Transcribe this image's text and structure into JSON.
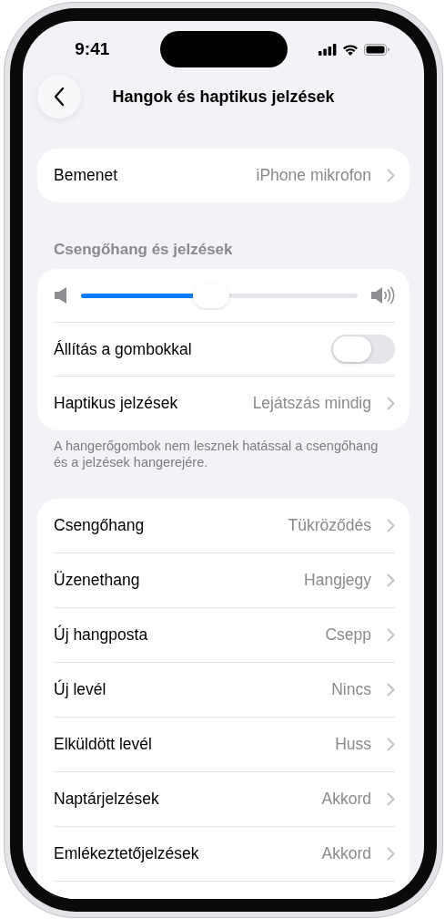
{
  "status_bar": {
    "time": "9:41"
  },
  "nav": {
    "title": "Hangok és haptikus jelzések"
  },
  "groups": [
    {
      "rows": [
        {
          "kind": "link",
          "label": "Bemenet",
          "value": "iPhone mikrofon"
        }
      ]
    },
    {
      "header": "Csengőhang és jelzések",
      "rows": [
        {
          "kind": "slider",
          "level": 0.47
        },
        {
          "kind": "toggle",
          "label": "Állítás a gombokkal",
          "on": false
        },
        {
          "kind": "link",
          "label": "Haptikus jelzések",
          "value": "Lejátszás mindig"
        }
      ],
      "footer": "A hangerőgombok nem lesznek hatással a csengőhang és a jelzések hangerejére."
    },
    {
      "rows": [
        {
          "kind": "link",
          "label": "Csengőhang",
          "value": "Tükröződés"
        },
        {
          "kind": "link",
          "label": "Üzenethang",
          "value": "Hangjegy"
        },
        {
          "kind": "link",
          "label": "Új hangposta",
          "value": "Csepp"
        },
        {
          "kind": "link",
          "label": "Új levél",
          "value": "Nincs"
        },
        {
          "kind": "link",
          "label": "Elküldött levél",
          "value": "Huss"
        },
        {
          "kind": "link",
          "label": "Naptárjelzések",
          "value": "Akkord"
        },
        {
          "kind": "link",
          "label": "Emlékeztetőjelzések",
          "value": "Akkord"
        }
      ]
    }
  ]
}
